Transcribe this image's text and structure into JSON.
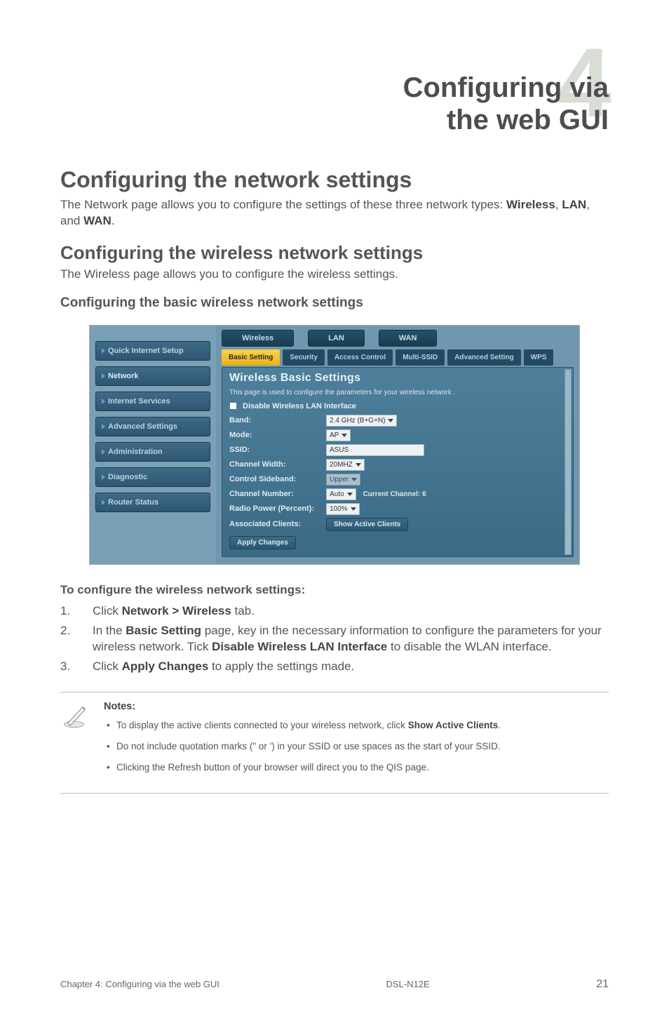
{
  "chapter": {
    "number": "4",
    "title_lines": [
      "Configuring via",
      "the web GUI"
    ]
  },
  "h1": "Configuring the network settings",
  "p1_a": "The Network page allows you to configure the settings of these three network types: ",
  "p1_b1": "Wireless",
  "p1_b2": "LAN",
  "p1_b3": "WAN",
  "h2": "Configuring the wireless network settings",
  "p2": "The Wireless page allows you to configure the wireless settings.",
  "h3": "Configuring the basic wireless network settings",
  "shot": {
    "sidebar": [
      "Quick Internet Setup",
      "Network",
      "Internet Services",
      "Advanced Settings",
      "Administration",
      "Diagnostic",
      "Router Status"
    ],
    "tabs": {
      "main": [
        "Wireless",
        "LAN",
        "WAN"
      ],
      "active": 0
    },
    "subtabs": [
      "Basic Setting",
      "Security",
      "Access Control",
      "Multi-SSID",
      "Advanced Setting",
      "WPS"
    ],
    "subtab_active": 0,
    "panel_title": "Wireless Basic Settings",
    "panel_note": "This page is used to configure the parameters for your wireless network .",
    "disable_label": "Disable Wireless LAN Interface",
    "rows": {
      "band": {
        "label": "Band:",
        "value": "2.4 GHz (B+G+N)"
      },
      "mode": {
        "label": "Mode:",
        "value": "AP"
      },
      "ssid": {
        "label": "SSID:",
        "value": "ASUS"
      },
      "chwidth": {
        "label": "Channel Width:",
        "value": "20MHZ"
      },
      "sideband": {
        "label": "Control Sideband:",
        "value": "Upper"
      },
      "chnum": {
        "label": "Channel Number:",
        "value": "Auto",
        "extra": "Current Channel: 6"
      },
      "radio": {
        "label": "Radio Power (Percent):",
        "value": "100%"
      },
      "assoc": {
        "label": "Associated Clients:",
        "button": "Show Active Clients"
      }
    },
    "apply": "Apply Changes"
  },
  "steps_lead": "To configure the wireless network settings:",
  "steps": {
    "s1_a": "Click ",
    "s1_b": "Network > Wireless",
    "s1_c": " tab.",
    "s2_a": "In the ",
    "s2_b": "Basic Setting",
    "s2_c": " page, key in the necessary information to configure the parameters for your wireless network. Tick ",
    "s2_d": "Disable Wireless LAN Interface",
    "s2_e": " to disable the WLAN interface.",
    "s3_a": "Click ",
    "s3_b": "Apply Changes",
    "s3_c": " to apply the settings made."
  },
  "notes": {
    "title": "Notes:",
    "n1_a": "To display the active clients connected to your wireless network, click ",
    "n1_b": "Show Active Clients",
    "n1_c": ".",
    "n2": "Do not include quotation marks (\" or ') in your SSID or use spaces as the start of your SSID.",
    "n3": "Clicking the Refresh button of your browser will direct you to the QIS page."
  },
  "footer": {
    "left": "Chapter 4: Configuring via the web GUI",
    "mid": "DSL-N12E",
    "right": "21"
  }
}
